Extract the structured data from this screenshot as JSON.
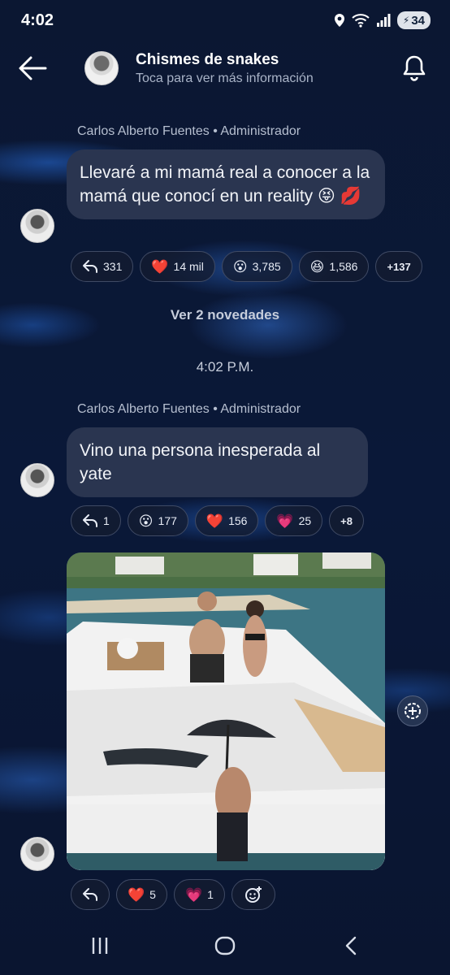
{
  "status_bar": {
    "time": "4:02",
    "battery": "34"
  },
  "header": {
    "title": "Chismes de snakes",
    "subtitle": "Toca para ver más información"
  },
  "messages": [
    {
      "sender": "Carlos Alberto Fuentes • Administrador",
      "text": "Llevaré a mi mamá real a conocer a la mamá que conocí en un reality 😝 💋",
      "reactions": [
        {
          "icon": "reply-icon",
          "emoji": "",
          "count": "331"
        },
        {
          "icon": "heart-icon",
          "emoji": "❤️",
          "count": "14 mil"
        },
        {
          "icon": "surprised-face-icon",
          "emoji": "😮",
          "count": "3,785"
        },
        {
          "icon": "laughing-face-icon",
          "emoji": "😆",
          "count": "1,586"
        },
        {
          "icon": "",
          "emoji": "",
          "count": "+137"
        }
      ]
    },
    {
      "sender": "Carlos Alberto Fuentes • Administrador",
      "text": "Vino una persona inesperada al yate",
      "reactions": [
        {
          "icon": "reply-icon",
          "emoji": "",
          "count": "1"
        },
        {
          "icon": "surprised-face-icon",
          "emoji": "😮",
          "count": "177"
        },
        {
          "icon": "heart-icon",
          "emoji": "❤️",
          "count": "156"
        },
        {
          "icon": "sparkling-heart-icon",
          "emoji": "💗",
          "count": "25"
        },
        {
          "icon": "",
          "emoji": "",
          "count": "+8"
        }
      ]
    },
    {
      "reactions": [
        {
          "icon": "reply-icon",
          "emoji": "",
          "count": ""
        },
        {
          "icon": "heart-icon",
          "emoji": "❤️",
          "count": "5"
        },
        {
          "icon": "sparkling-heart-icon",
          "emoji": "💗",
          "count": "1"
        },
        {
          "icon": "add-reaction-icon",
          "emoji": "",
          "count": ""
        }
      ]
    }
  ],
  "novedades": "Ver 2 novedades",
  "timestamp": "4:02 P.M.",
  "colors": {
    "bubble": "#2a3550",
    "background": "#0a1838"
  }
}
